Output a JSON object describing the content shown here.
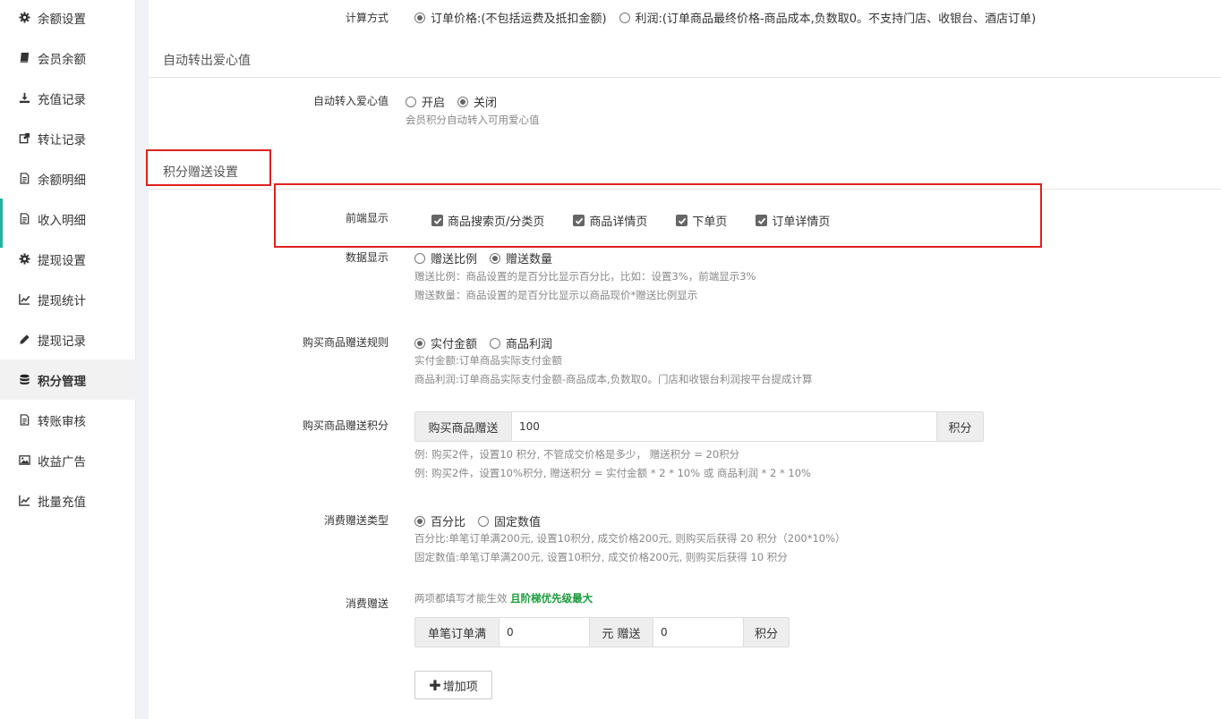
{
  "sidebar": {
    "items": [
      {
        "label": "余额设置",
        "icon": "gear-icon"
      },
      {
        "label": "会员余额",
        "icon": "book-icon"
      },
      {
        "label": "充值记录",
        "icon": "download-icon"
      },
      {
        "label": "转让记录",
        "icon": "external-link-icon"
      },
      {
        "label": "余额明细",
        "icon": "document-icon"
      },
      {
        "label": "收入明细",
        "icon": "document-icon"
      },
      {
        "label": "提现设置",
        "icon": "gear-icon"
      },
      {
        "label": "提现统计",
        "icon": "line-chart-icon"
      },
      {
        "label": "提现记录",
        "icon": "pencil-icon"
      },
      {
        "label": "积分管理",
        "icon": "database-icon"
      },
      {
        "label": "转账审核",
        "icon": "document-icon"
      },
      {
        "label": "收益广告",
        "icon": "image-icon"
      },
      {
        "label": "批量充值",
        "icon": "line-chart-icon"
      }
    ],
    "active": "积分管理"
  },
  "calc_method": {
    "label": "计算方式",
    "options": [
      "订单价格:(不包括运费及抵扣金额)",
      "利润:(订单商品最终价格-商品成本,负数取0。不支持门店、收银台、酒店订单)"
    ],
    "selected": "订单价格:(不包括运费及抵扣金额)"
  },
  "section_love": {
    "title": "自动转出爱心值"
  },
  "auto_love": {
    "label": "自动转入爱心值",
    "options": [
      "开启",
      "关闭"
    ],
    "selected": "关闭",
    "help": "会员积分自动转入可用爱心值"
  },
  "section_points": {
    "title": "积分赠送设置"
  },
  "frontend_display": {
    "label": "前端显示",
    "options": [
      "商品搜索页/分类页",
      "商品详情页",
      "下单页",
      "订单详情页"
    ],
    "checked": [
      true,
      true,
      true,
      true
    ]
  },
  "data_display": {
    "label": "数据显示",
    "options": [
      "赠送比例",
      "赠送数量"
    ],
    "selected": "赠送数量",
    "help": [
      "赠送比例：商品设置的是百分比显示百分比，比如：设置3%，前端显示3%",
      "赠送数量：商品设置的是百分比显示以商品现价*赠送比例显示"
    ]
  },
  "buy_rule": {
    "label": "购买商品赠送规则",
    "options": [
      "实付金额",
      "商品利润"
    ],
    "selected": "实付金额",
    "help": [
      "实付金额:订单商品实际支付金额",
      "商品利润:订单商品实际支付金额-商品成本,负数取0。门店和收银台利润按平台提成计算"
    ]
  },
  "buy_points": {
    "label": "购买商品赠送积分",
    "prefix": "购买商品赠送",
    "value": "100",
    "suffix": "积分",
    "help": [
      "例: 购买2件，设置10 积分, 不管成交价格是多少， 赠送积分 = 20积分",
      "例: 购买2件，设置10%积分, 赠送积分 = 实付金额 * 2 * 10% 或 商品利润 * 2 * 10%"
    ]
  },
  "consume_type": {
    "label": "消费赠送类型",
    "options": [
      "百分比",
      "固定数值"
    ],
    "selected": "百分比",
    "help": [
      "百分比:单笔订单满200元, 设置10积分, 成交价格200元, 则购买后获得 20 积分（200*10%）",
      "固定数值:单笔订单满200元, 设置10积分, 成交价格200元, 则购买后获得 10 积分"
    ]
  },
  "consume_gift": {
    "label": "消费赠送",
    "help_prefix": "两项都填写才能生效",
    "help_emph": "且阶梯优先级最大",
    "prefix": "单笔订单满",
    "value1": "0",
    "middle": "元 赠送",
    "value2": "0",
    "suffix": "积分",
    "add_button": "增加项"
  },
  "colors": {
    "highlight_box": "#e02020",
    "accent": "#1fb5a0",
    "emphasis_green": "#1a9a3a"
  }
}
